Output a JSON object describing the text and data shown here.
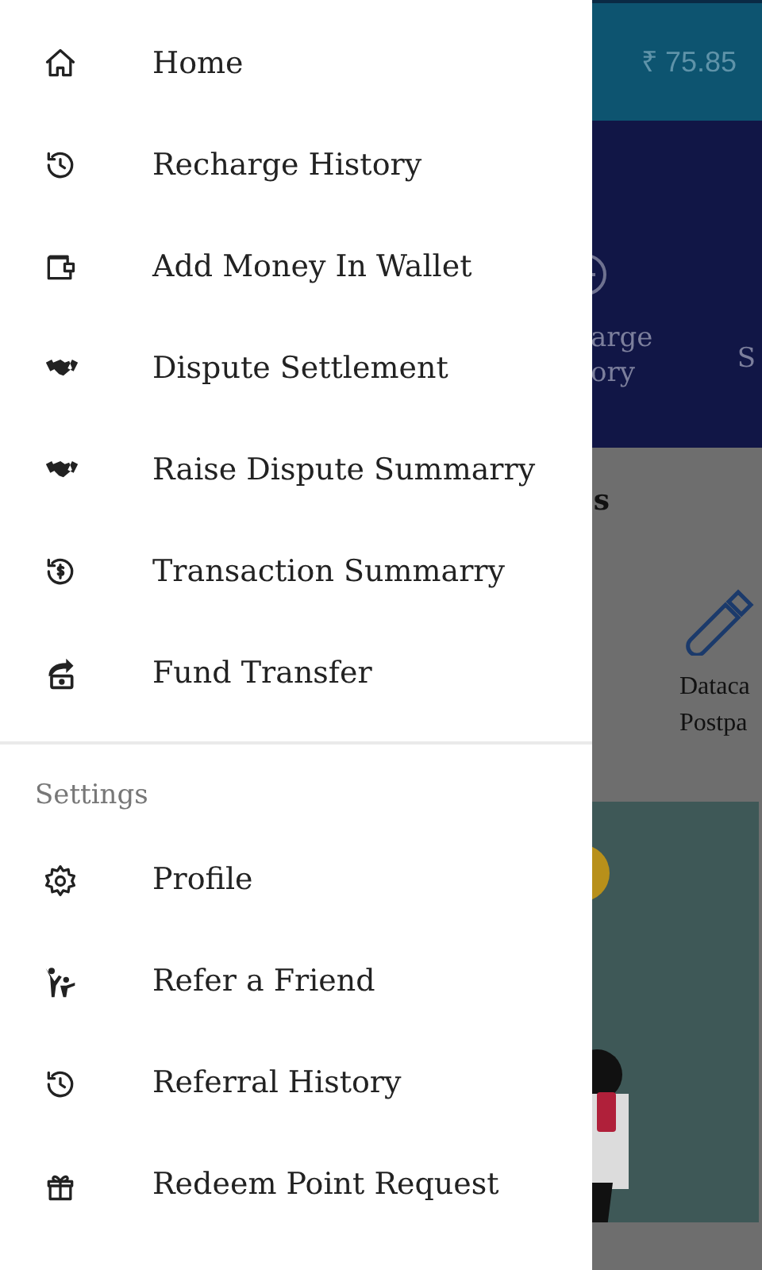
{
  "background": {
    "balance": "₹ 75.85",
    "tile_texts": [
      "arge",
      "ory"
    ],
    "tile_edge_text": "S",
    "section_heading_fragment": "s",
    "service_texts": [
      "Dataca",
      "Postpa"
    ]
  },
  "drawer": {
    "items": [
      {
        "label": "Home"
      },
      {
        "label": "Recharge History"
      },
      {
        "label": "Add Money In Wallet"
      },
      {
        "label": "Dispute Settlement"
      },
      {
        "label": "Raise Dispute Summarry"
      },
      {
        "label": "Transaction Summarry"
      },
      {
        "label": "Fund Transfer"
      }
    ],
    "settings_heading": "Settings",
    "settings_items": [
      {
        "label": "Profile"
      },
      {
        "label": "Refer a Friend"
      },
      {
        "label": "Referral History"
      },
      {
        "label": "Redeem Point Request"
      }
    ]
  }
}
